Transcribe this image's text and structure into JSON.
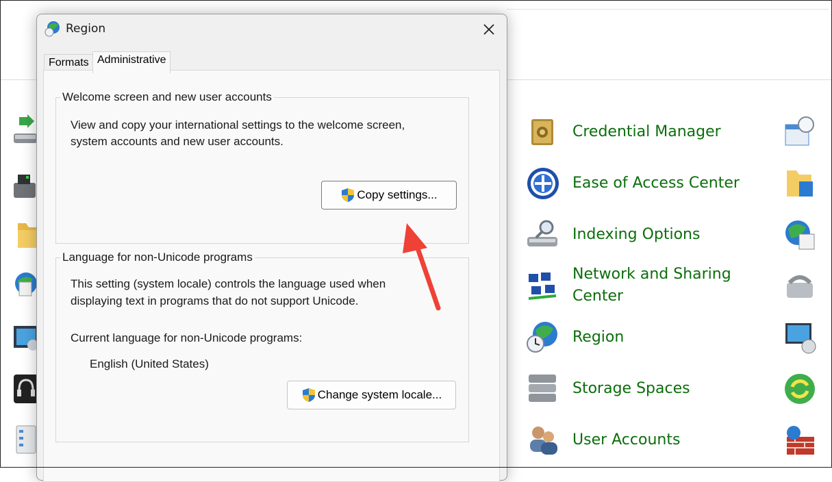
{
  "dialog": {
    "title": "Region",
    "tabs": [
      {
        "label": "Formats",
        "selected": false
      },
      {
        "label": "Administrative",
        "selected": true
      }
    ],
    "welcome_group": {
      "legend": "Welcome screen and new user accounts",
      "description_line1": "View and copy your international settings to the welcome screen,",
      "description_line2": "system accounts and new user accounts.",
      "button_label": "Copy settings..."
    },
    "unicode_group": {
      "legend": "Language for non-Unicode programs",
      "description_line1": "This setting (system locale) controls the language used when",
      "description_line2": "displaying text in programs that do not support Unicode.",
      "current_label": "Current language for non-Unicode programs:",
      "current_value": "English (United States)",
      "button_label": "Change system locale..."
    }
  },
  "control_panel": {
    "items": [
      {
        "label": "Credential Manager",
        "icon": "safe-icon"
      },
      {
        "label": "Ease of Access Center",
        "icon": "ease-of-access-icon"
      },
      {
        "label": "Indexing Options",
        "icon": "indexing-icon"
      },
      {
        "label_line1": "Network and Sharing",
        "label_line2": "Center",
        "icon": "network-icon"
      },
      {
        "label": "Region",
        "icon": "region-globe-icon"
      },
      {
        "label": "Storage Spaces",
        "icon": "storage-icon"
      },
      {
        "label": "User Accounts",
        "icon": "users-icon"
      }
    ],
    "link_color": "#0b6e0b"
  },
  "annotation": {
    "color": "#ef4136",
    "icon": "arrow-annotation"
  }
}
